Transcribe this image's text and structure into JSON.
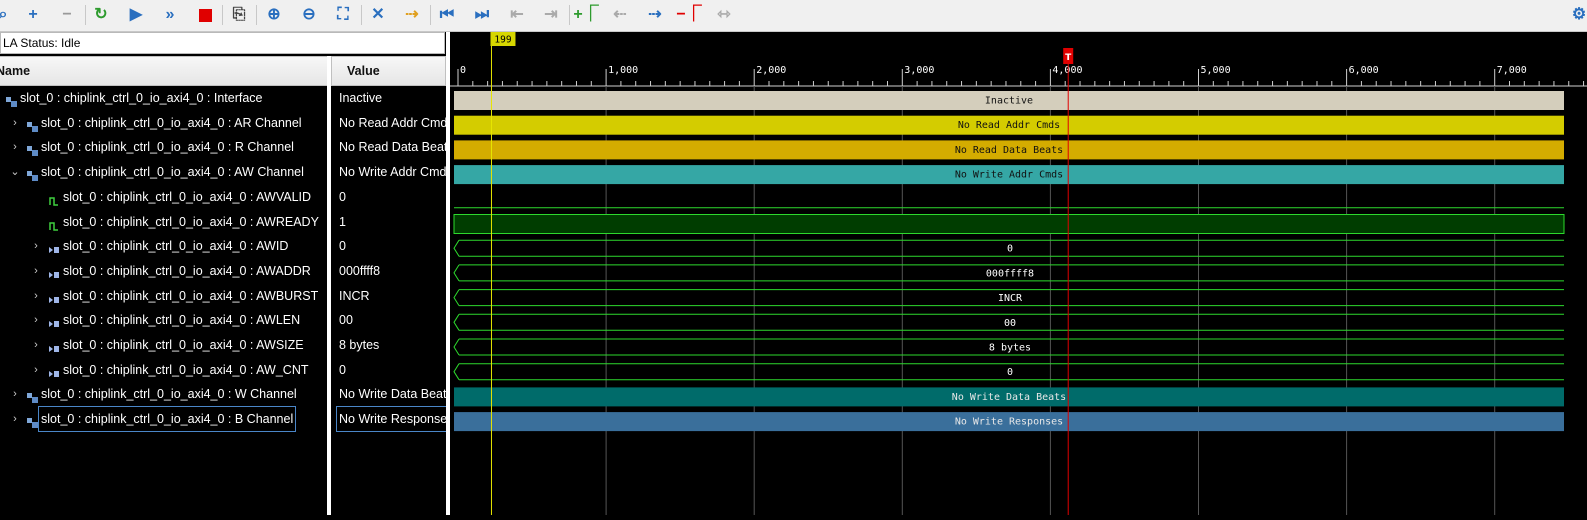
{
  "toolbar": {
    "icons": [
      "search-icon",
      "add-icon",
      "remove-icon",
      "run-trigger-icon",
      "run-icon",
      "run-immediate-icon",
      "stop-icon",
      "export-icon",
      "zoom-in-icon",
      "zoom-out-icon",
      "zoom-fit-icon",
      "cursor-icon",
      "go-to-cursor-icon",
      "go-to-start-icon",
      "go-to-end-icon",
      "previous-transition-icon",
      "next-transition-icon",
      "add-marker-icon",
      "previous-marker-icon",
      "next-marker-icon",
      "delete-marker-icon",
      "swap-cursors-icon",
      "settings-icon"
    ],
    "colors": {
      "run": "#2a6fbf",
      "stop": "#e00000",
      "green": "#2e9b2e"
    }
  },
  "status": {
    "text": "LA Status: Idle"
  },
  "columns": {
    "name": "Name",
    "value": "Value"
  },
  "signals": [
    {
      "name": "slot_0 : chiplink_ctrl_0_io_axi4_0 : Interface",
      "value": "Inactive",
      "wave": "Inactive",
      "kind": "interface",
      "expander": ""
    },
    {
      "name": "slot_0 : chiplink_ctrl_0_io_axi4_0 : AR Channel",
      "value": "No Read Addr Cmds",
      "wave": "No Read Addr Cmds",
      "kind": "channel",
      "expander": "›"
    },
    {
      "name": "slot_0 : chiplink_ctrl_0_io_axi4_0 : R Channel",
      "value": "No Read Data Beats",
      "wave": "No Read Data Beats",
      "kind": "channel",
      "expander": "›"
    },
    {
      "name": "slot_0 : chiplink_ctrl_0_io_axi4_0 : AW Channel",
      "value": "No Write Addr Cmds",
      "wave": "No Write Addr Cmds",
      "kind": "channel",
      "expander": "⌄"
    },
    {
      "name": "slot_0 : chiplink_ctrl_0_io_axi4_0 : AWVALID",
      "value": "0",
      "wave": "",
      "kind": "bit",
      "expander": ""
    },
    {
      "name": "slot_0 : chiplink_ctrl_0_io_axi4_0 : AWREADY",
      "value": "1",
      "wave": "",
      "kind": "bit",
      "expander": ""
    },
    {
      "name": "slot_0 : chiplink_ctrl_0_io_axi4_0 : AWID",
      "value": "0",
      "wave": "0",
      "kind": "bus",
      "expander": "›"
    },
    {
      "name": "slot_0 : chiplink_ctrl_0_io_axi4_0 : AWADDR",
      "value": "000ffff8",
      "wave": "000ffff8",
      "kind": "bus",
      "expander": "›"
    },
    {
      "name": "slot_0 : chiplink_ctrl_0_io_axi4_0 : AWBURST",
      "value": "INCR",
      "wave": "INCR",
      "kind": "bus",
      "expander": "›"
    },
    {
      "name": "slot_0 : chiplink_ctrl_0_io_axi4_0 : AWLEN",
      "value": "00",
      "wave": "00",
      "kind": "bus",
      "expander": "›"
    },
    {
      "name": "slot_0 : chiplink_ctrl_0_io_axi4_0 : AWSIZE",
      "value": "8 bytes",
      "wave": "8 bytes",
      "kind": "bus",
      "expander": "›"
    },
    {
      "name": "slot_0 : chiplink_ctrl_0_io_axi4_0 : AW_CNT",
      "value": "0",
      "wave": "0",
      "kind": "bus",
      "expander": "›"
    },
    {
      "name": "slot_0 : chiplink_ctrl_0_io_axi4_0 : W Channel",
      "value": "No Write Data Beats",
      "wave": "No Write Data Beats",
      "kind": "channel",
      "expander": "›"
    },
    {
      "name": "slot_0 : chiplink_ctrl_0_io_axi4_0 : B Channel",
      "value": "No Write Response",
      "wave": "No Write Responses",
      "kind": "channel",
      "expander": "›",
      "selected": true
    }
  ],
  "waveform": {
    "ticks": [
      "0",
      "1,000",
      "2,000",
      "3,000",
      "4,000",
      "5,000",
      "6,000",
      "7,000"
    ],
    "tick_values": [
      0,
      1000,
      2000,
      3000,
      4000,
      5000,
      6000,
      7000
    ],
    "cursor_label": "199",
    "cursor_value": 199,
    "trigger_label": "T",
    "trigger_value": 4100,
    "colors": {
      "interface": "#d4cebc",
      "ar": "#d4cc00",
      "r": "#d4ac00",
      "aw": "#35a7a5",
      "bus_line": "#2dd92d",
      "awready_fill": "#003d00",
      "w": "#006b6a",
      "b": "#3a6f9b",
      "grid": "#555555",
      "cursor": "#e6e600",
      "trigger": "#e00000"
    }
  }
}
